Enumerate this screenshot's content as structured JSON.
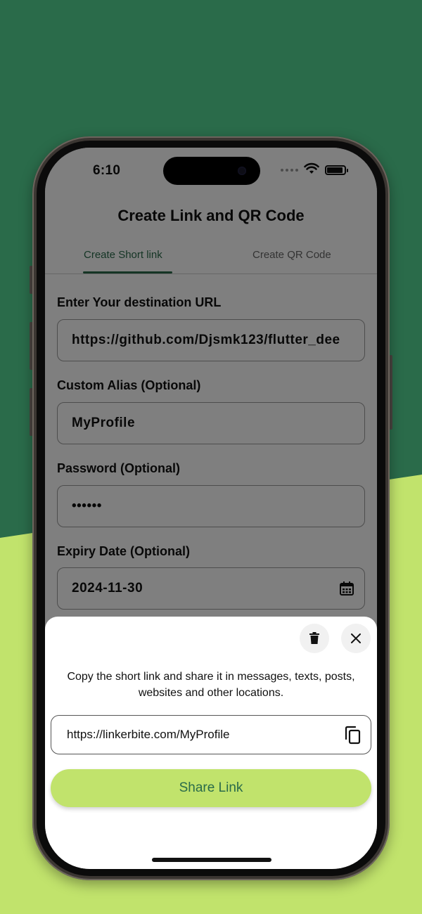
{
  "colors": {
    "bg_dark": "#2a6b4a",
    "bg_light": "#c1e36c",
    "accent": "#2a6b4a",
    "button": "#c1e36c"
  },
  "status_bar": {
    "time": "6:10"
  },
  "app": {
    "title": "Create Link and QR Code",
    "tabs": [
      {
        "label": "Create Short link",
        "active": true
      },
      {
        "label": "Create QR Code",
        "active": false
      }
    ]
  },
  "form": {
    "url_label": "Enter Your destination URL",
    "url_value": "https://github.com/Djsmk123/flutter_dee",
    "alias_label": "Custom Alias (Optional)",
    "alias_value": "MyProfile",
    "password_label": "Password (Optional)",
    "password_value": "••••••",
    "expiry_label": "Expiry Date (Optional)",
    "expiry_value": "2024-11-30"
  },
  "sheet": {
    "message": "Copy the short link and share it in messages, texts, posts, websites and other locations.",
    "short_link": "https://linkerbite.com/MyProfile",
    "share_label": "Share Link"
  }
}
